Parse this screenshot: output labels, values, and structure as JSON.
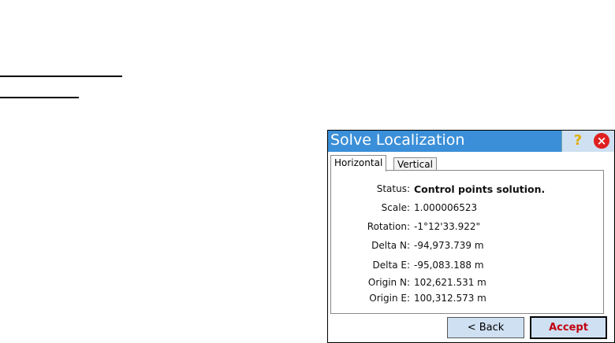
{
  "dialog": {
    "title": "Solve Localization",
    "help_icon": "?",
    "close_icon": "×",
    "tabs": [
      {
        "label": "Horizontal"
      },
      {
        "label": "Vertical"
      }
    ],
    "fields": [
      {
        "label": "Status:",
        "value": "Control points solution."
      },
      {
        "label": "Scale:",
        "value": "1.000006523"
      },
      {
        "label": "Rotation:",
        "value": "-1°12'33.922\""
      },
      {
        "label": "Delta N:",
        "value": "-94,973.739 m"
      },
      {
        "label": "Delta E:",
        "value": "-95,083.188 m"
      },
      {
        "label": "Origin N:",
        "value": "102,621.531 m"
      },
      {
        "label": "Origin E:",
        "value": "100,312.573 m"
      }
    ],
    "back_label": "< Back",
    "accept_label": "Accept"
  }
}
